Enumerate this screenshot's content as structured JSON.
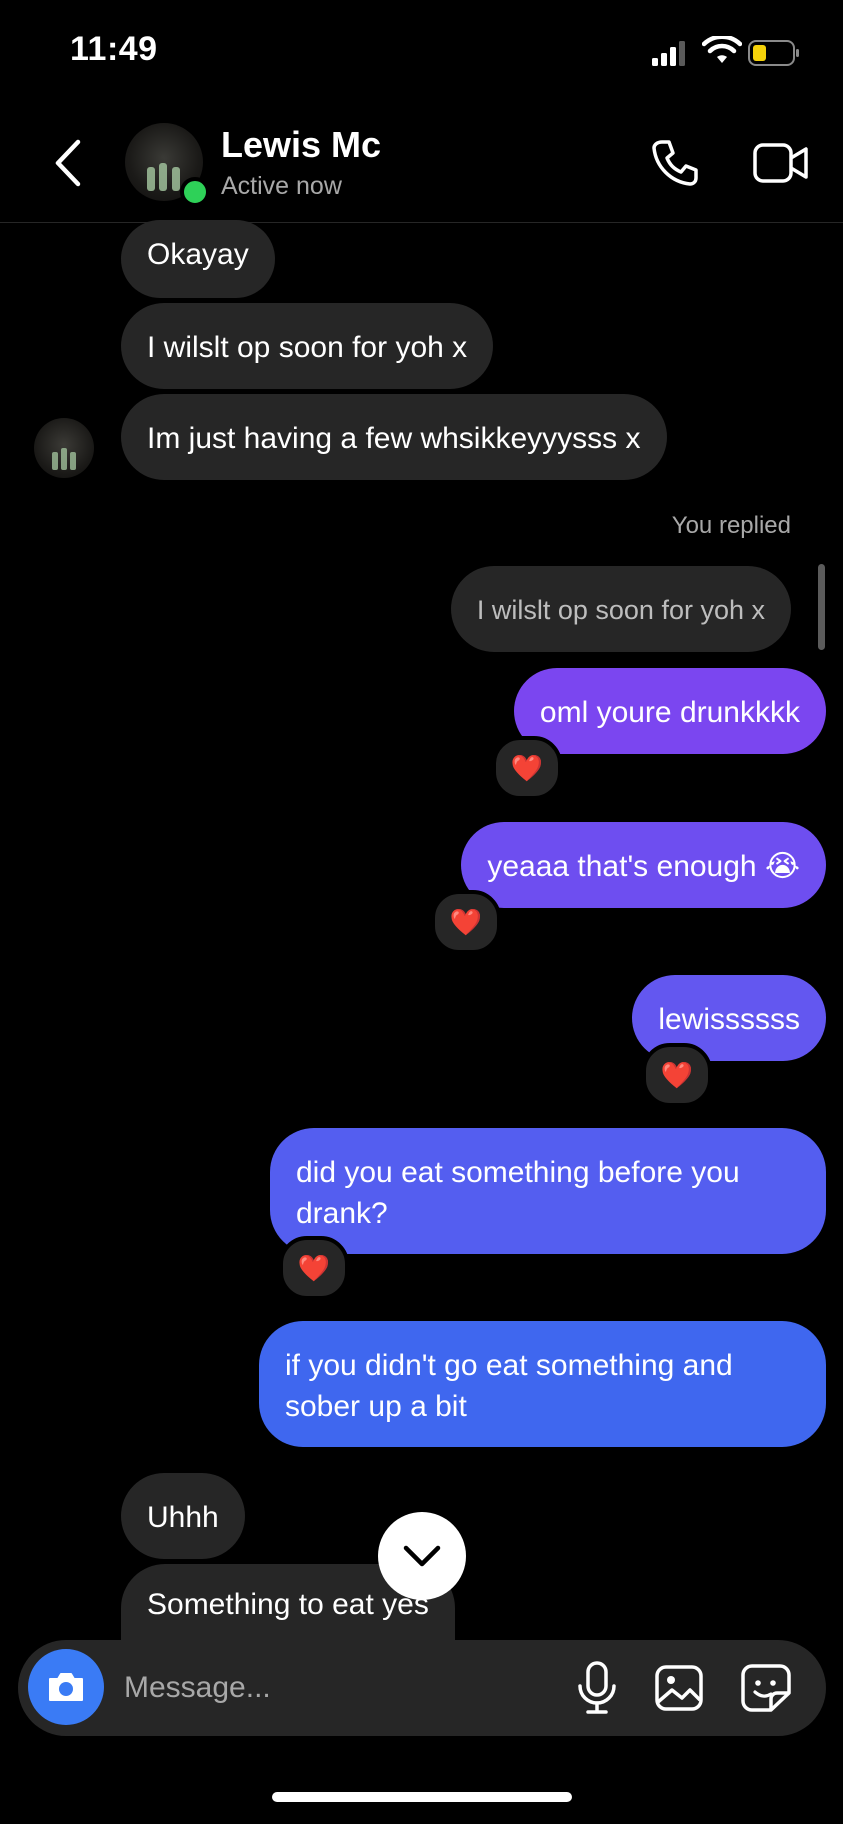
{
  "status_bar": {
    "time": "11:49"
  },
  "header": {
    "name": "Lewis Mc",
    "status": "Active now"
  },
  "messages": {
    "m1": "Okayay",
    "m2": "I wilslt op soon for yoh x",
    "m3": "Im just having a few whsikkeyyysss x",
    "replied_label": "You replied",
    "reply_quote": "I wilslt op soon for yoh x",
    "o1": "oml youre drunkkkk",
    "o2": "yeaaa that's enough 😭",
    "o3": "lewissssss",
    "o4_line1": "did you eat something before you",
    "o4_line2": "drank?",
    "o5_line1": "if you didn't go eat something and",
    "o5_line2": "sober up a bit",
    "m4": "Uhhh",
    "m5": "Something to eat yes",
    "reaction": "❤️"
  },
  "composer": {
    "placeholder": "Message..."
  },
  "colors": {
    "incoming_bubble": "#262626",
    "out_1": "#7b46f0",
    "out_2": "#6e4ef0",
    "out_3": "#6357f0",
    "out_4": "#545ef0",
    "out_5": "#3f67ef",
    "online": "#2ed158",
    "camera": "#3a7bf5"
  },
  "icons": [
    "back-icon",
    "phone-icon",
    "video-camera-icon",
    "camera-icon",
    "microphone-icon",
    "gallery-icon",
    "sticker-icon",
    "chevron-down-icon"
  ]
}
